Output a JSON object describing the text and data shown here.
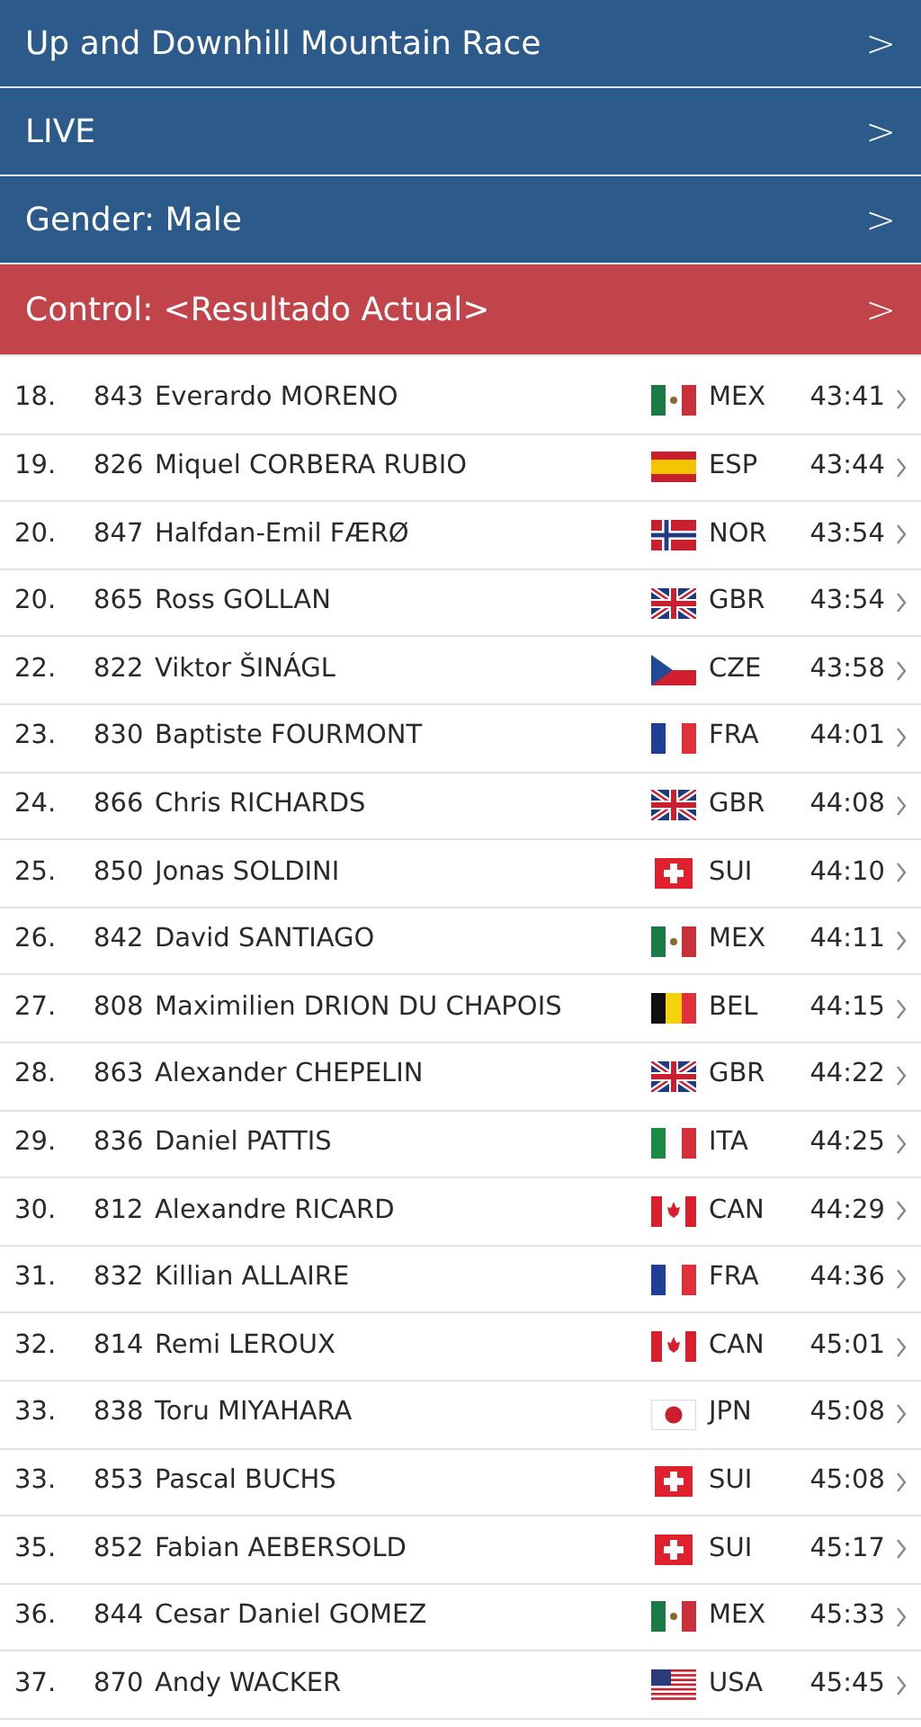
{
  "menu": [
    {
      "label": "Up and Downhill Mountain Race",
      "selected": false,
      "chevron": ">"
    },
    {
      "label": "LIVE",
      "selected": false,
      "chevron": ">"
    },
    {
      "label": "Gender: Male",
      "selected": false,
      "chevron": ">"
    },
    {
      "label": "Control: <Resultado Actual>",
      "selected": true,
      "chevron": ">"
    }
  ],
  "results": [
    {
      "rank": "18.",
      "bib": "843",
      "name": "Everardo MORENO",
      "kind": "mx",
      "country": "MEX",
      "time": "43:41"
    },
    {
      "rank": "19.",
      "bib": "826",
      "name": "Miquel CORBERA RUBIO",
      "kind": "es",
      "country": "ESP",
      "time": "43:44"
    },
    {
      "rank": "20.",
      "bib": "847",
      "name": "Halfdan-Emil FÆRØ",
      "kind": "no",
      "country": "NOR",
      "time": "43:54"
    },
    {
      "rank": "20.",
      "bib": "865",
      "name": "Ross GOLLAN",
      "kind": "gb",
      "country": "GBR",
      "time": "43:54"
    },
    {
      "rank": "22.",
      "bib": "822",
      "name": "Viktor ŠINÁGL",
      "kind": "cz",
      "country": "CZE",
      "time": "43:58"
    },
    {
      "rank": "23.",
      "bib": "830",
      "name": "Baptiste FOURMONT",
      "kind": "fr",
      "country": "FRA",
      "time": "44:01"
    },
    {
      "rank": "24.",
      "bib": "866",
      "name": "Chris RICHARDS",
      "kind": "gb",
      "country": "GBR",
      "time": "44:08"
    },
    {
      "rank": "25.",
      "bib": "850",
      "name": "Jonas SOLDINI",
      "kind": "ch",
      "country": "SUI",
      "time": "44:10"
    },
    {
      "rank": "26.",
      "bib": "842",
      "name": "David SANTIAGO",
      "kind": "mx",
      "country": "MEX",
      "time": "44:11"
    },
    {
      "rank": "27.",
      "bib": "808",
      "name": "Maximilien DRION DU CHAPOIS",
      "kind": "be",
      "country": "BEL",
      "time": "44:15"
    },
    {
      "rank": "28.",
      "bib": "863",
      "name": "Alexander CHEPELIN",
      "kind": "gb",
      "country": "GBR",
      "time": "44:22"
    },
    {
      "rank": "29.",
      "bib": "836",
      "name": "Daniel PATTIS",
      "kind": "it",
      "country": "ITA",
      "time": "44:25"
    },
    {
      "rank": "30.",
      "bib": "812",
      "name": "Alexandre RICARD",
      "kind": "ca",
      "country": "CAN",
      "time": "44:29"
    },
    {
      "rank": "31.",
      "bib": "832",
      "name": "Killian ALLAIRE",
      "kind": "fr",
      "country": "FRA",
      "time": "44:36"
    },
    {
      "rank": "32.",
      "bib": "814",
      "name": "Remi LEROUX",
      "kind": "ca",
      "country": "CAN",
      "time": "45:01"
    },
    {
      "rank": "33.",
      "bib": "838",
      "name": "Toru MIYAHARA",
      "kind": "jp",
      "country": "JPN",
      "time": "45:08"
    },
    {
      "rank": "33.",
      "bib": "853",
      "name": "Pascal BUCHS",
      "kind": "ch",
      "country": "SUI",
      "time": "45:08"
    },
    {
      "rank": "35.",
      "bib": "852",
      "name": "Fabian AEBERSOLD",
      "kind": "ch",
      "country": "SUI",
      "time": "45:17"
    },
    {
      "rank": "36.",
      "bib": "844",
      "name": "Cesar Daniel GOMEZ",
      "kind": "mx",
      "country": "MEX",
      "time": "45:33"
    },
    {
      "rank": "37.",
      "bib": "870",
      "name": "Andy WACKER",
      "kind": "us",
      "country": "USA",
      "time": "45:45"
    }
  ]
}
